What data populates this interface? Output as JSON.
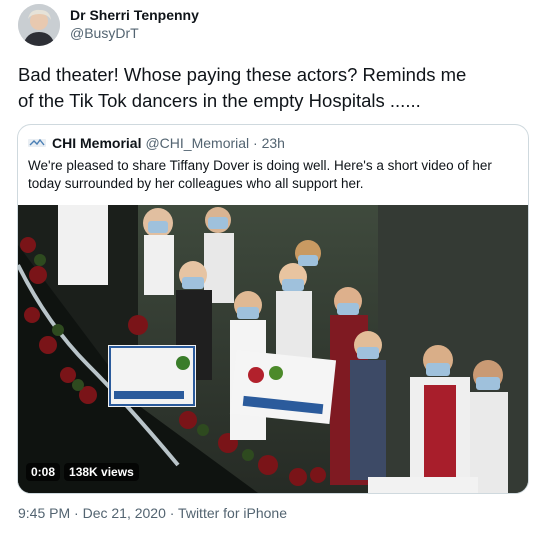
{
  "author": {
    "name": "Dr Sherri Tenpenny",
    "handle": "@BusyDrT"
  },
  "tweet": {
    "text": "Bad theater!  Whose paying these actors? Reminds me\nof the Tik Tok dancers in the empty Hospitals ......"
  },
  "quoted": {
    "name": "CHI Memorial",
    "meta": "@CHI_Memorial · 23h",
    "text": "We're pleased to share Tiffany Dover is doing well. Here's a short video of her today surrounded by her colleagues who all support her.",
    "video": {
      "time": "0:08",
      "views": "138K views"
    }
  },
  "footer": {
    "meta": "9:45 PM · Dec 21, 2020 · Twitter for iPhone"
  }
}
